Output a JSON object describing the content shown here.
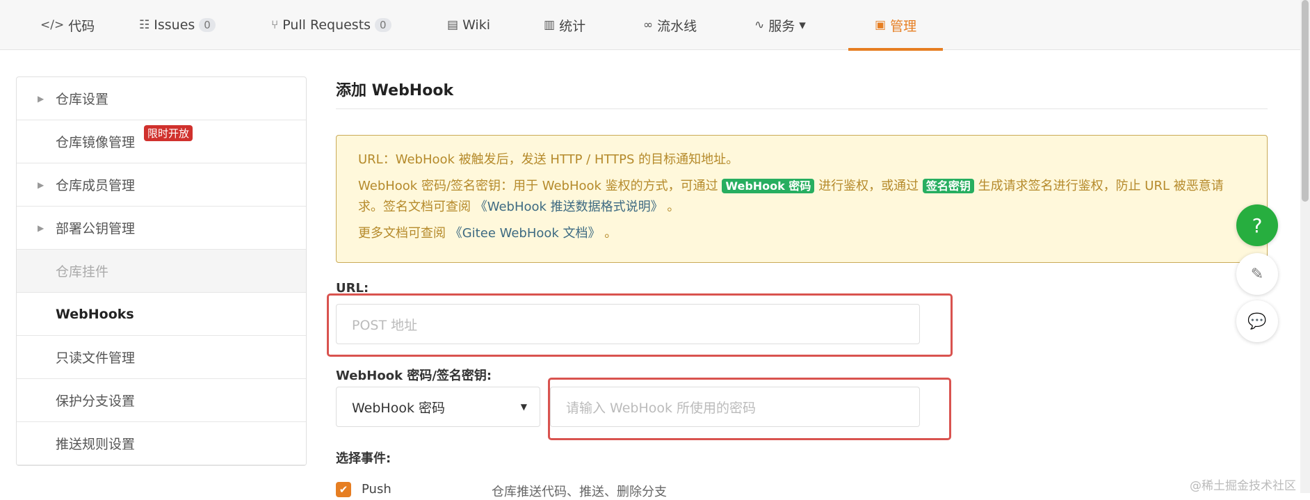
{
  "nav": {
    "tabs": [
      {
        "icon": "code-icon",
        "glyph": "</>",
        "label": "代码"
      },
      {
        "icon": "issues-icon",
        "glyph": "☷",
        "label": "Issues",
        "count": "0"
      },
      {
        "icon": "pull-request-icon",
        "glyph": "⑂",
        "label": "Pull Requests",
        "count": "0"
      },
      {
        "icon": "wiki-icon",
        "glyph": "▤",
        "label": "Wiki"
      },
      {
        "icon": "stats-icon",
        "glyph": "▥",
        "label": "统计"
      },
      {
        "icon": "pipeline-icon",
        "glyph": "∞",
        "label": "流水线"
      },
      {
        "icon": "service-icon",
        "glyph": "∿",
        "label": "服务",
        "caret": "▾"
      },
      {
        "icon": "manage-icon",
        "glyph": "▣",
        "label": "管理"
      }
    ]
  },
  "sidebar": {
    "items": [
      {
        "label": "仓库设置",
        "arrow": "▶"
      },
      {
        "label": "仓库镜像管理",
        "badge": "限时开放"
      },
      {
        "label": "仓库成员管理",
        "arrow": "▶"
      },
      {
        "label": "部署公钥管理",
        "arrow": "▶"
      },
      {
        "label": "仓库挂件"
      },
      {
        "label": "WebHooks"
      },
      {
        "label": "只读文件管理"
      },
      {
        "label": "保护分支设置"
      },
      {
        "label": "推送规则设置"
      }
    ]
  },
  "main": {
    "title": "添加 WebHook",
    "notice": {
      "line1": "URL：WebHook 被触发后，发送 HTTP / HTTPS 的目标通知地址。",
      "line2a": "WebHook 密码/签名密钥：用于 WebHook 鉴权的方式，可通过 ",
      "tag1": "WebHook 密码",
      "line2b": " 进行鉴权，或通过 ",
      "tag2": "签名密钥",
      "line2c": " 生成请求签名进行鉴权，防止 URL 被恶意请求。签名文档可查阅 ",
      "link1": "《WebHook 推送数据格式说明》",
      "line2d": " 。",
      "line3a": "更多文档可查阅 ",
      "link2": "《Gitee WebHook 文档》",
      "line3b": " 。"
    },
    "url_label": "URL:",
    "url_placeholder": "POST 地址",
    "secret_label": "WebHook 密码/签名密钥:",
    "secret_select": "WebHook 密码",
    "secret_placeholder": "请输入 WebHook 所使用的密码",
    "events_label": "选择事件:",
    "event_push": {
      "label": "Push",
      "desc": "仓库推送代码、推送、删除分支",
      "checked": true
    }
  },
  "fab": {
    "help": "?"
  },
  "watermark": "@稀土掘金技术社区",
  "colors": {
    "accent": "#e67e22",
    "green": "#27ae60",
    "highlight": "#d9534f"
  }
}
